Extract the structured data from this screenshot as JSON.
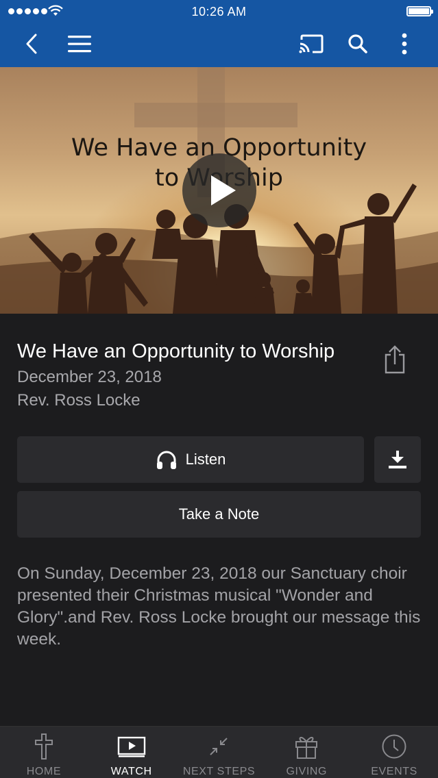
{
  "status_bar": {
    "time": "10:26 AM"
  },
  "nav": {
    "back_icon": "chevron-left-icon",
    "menu_icon": "hamburger-icon",
    "cast_icon": "cast-icon",
    "search_icon": "search-icon",
    "more_icon": "more-vertical-icon"
  },
  "hero": {
    "title_line1": "We Have an Opportunity",
    "title_line2": "to Worship",
    "play_icon": "play-icon"
  },
  "sermon": {
    "title": "We Have an Opportunity to Worship",
    "date": "December 23, 2018",
    "speaker": "Rev. Ross Locke",
    "description": "On Sunday, December 23, 2018 our Sanctuary choir presented their Christmas musical \"Wonder and Glory\".and Rev. Ross Locke brought our message this week."
  },
  "actions": {
    "listen_label": "Listen",
    "take_note_label": "Take a Note",
    "download_icon": "download-icon",
    "share_icon": "share-icon",
    "headphones_icon": "headphones-icon"
  },
  "tabs": [
    {
      "label": "HOME",
      "icon": "cross-icon",
      "active": false
    },
    {
      "label": "WATCH",
      "icon": "video-play-icon",
      "active": true
    },
    {
      "label": "NEXT STEPS",
      "icon": "arrows-collapse-icon",
      "active": false
    },
    {
      "label": "GIVING",
      "icon": "gift-icon",
      "active": false
    },
    {
      "label": "EVENTS",
      "icon": "clock-icon",
      "active": false
    }
  ],
  "colors": {
    "nav_bar": "#1556a3",
    "background": "#1c1c1e",
    "button_bg": "#2b2b2e",
    "tab_bar": "#2a2a2d"
  }
}
